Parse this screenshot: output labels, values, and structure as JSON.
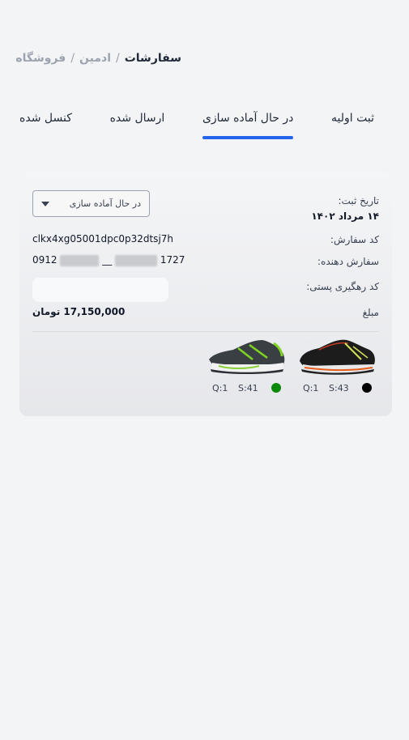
{
  "breadcrumb": {
    "current": "سفارشات",
    "separator": "/",
    "items": [
      "ادمین",
      "فروشگاه"
    ]
  },
  "tabs": [
    {
      "label": "ثبت اولیه",
      "active": false
    },
    {
      "label": "در حال آماده سازی",
      "active": true
    },
    {
      "label": "ارسال شده",
      "active": false
    },
    {
      "label": "کنسل شده",
      "active": false
    }
  ],
  "order": {
    "status_value": "در حال آماده سازی",
    "date_label": "تاریخ ثبت:",
    "date_value": "۱۴ مرداد ۱۴۰۲",
    "code_label": "کد سفارش:",
    "code_value": "clkx4xg05001dpc0p32dtsj7h",
    "customer_label": "سفارش دهنده:",
    "phone_prefix": "0912",
    "phone_separator": "__",
    "phone_suffix": "1727",
    "tracking_label": "کد رهگیری پستی:",
    "tracking_value": "",
    "amount_label": "مبلغ",
    "amount_value": "17,150,000 تومان"
  },
  "products": [
    {
      "quantity": "Q:1",
      "size": "S:43",
      "color": "#000000",
      "icon": "running-shoe-black-icon"
    },
    {
      "quantity": "Q:1",
      "size": "S:41",
      "color": "#0a8a0a",
      "icon": "running-shoe-green-icon"
    }
  ],
  "colors": {
    "accent": "#2563eb",
    "page_bg": "#f3f4f6"
  }
}
